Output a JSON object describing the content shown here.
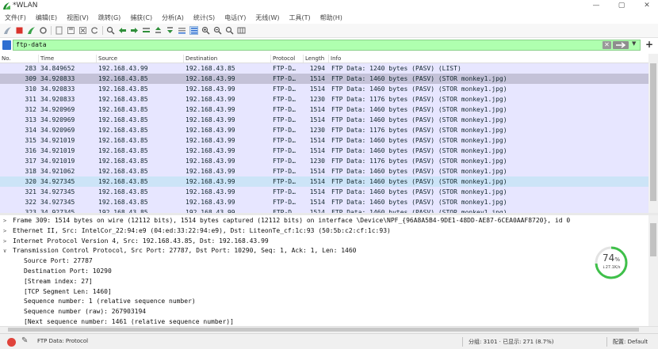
{
  "window": {
    "title": "*WLAN",
    "minimize": "—",
    "maximize": "▢",
    "close": "✕"
  },
  "menu": [
    "文件(F)",
    "编辑(E)",
    "视图(V)",
    "跳转(G)",
    "捕获(C)",
    "分析(A)",
    "统计(S)",
    "电话(Y)",
    "无线(W)",
    "工具(T)",
    "帮助(H)"
  ],
  "filter": {
    "value": "ftp-data",
    "clear": "✕",
    "dropdown": "▼",
    "add": "+"
  },
  "columns": [
    "No.",
    "Time",
    "Source",
    "Destination",
    "Protocol",
    "Length",
    "Info"
  ],
  "packets": [
    {
      "no": "283",
      "time": "34.849652",
      "src": "192.168.43.99",
      "dst": "192.168.43.85",
      "proto": "FTP-D…",
      "len": "1294",
      "info": "FTP Data: 1240 bytes (PASV) (LIST)"
    },
    {
      "no": "309",
      "time": "34.920833",
      "src": "192.168.43.85",
      "dst": "192.168.43.99",
      "proto": "FTP-D…",
      "len": "1514",
      "info": "FTP Data: 1460 bytes (PASV) (STOR monkey1.jpg)"
    },
    {
      "no": "310",
      "time": "34.920833",
      "src": "192.168.43.85",
      "dst": "192.168.43.99",
      "proto": "FTP-D…",
      "len": "1514",
      "info": "FTP Data: 1460 bytes (PASV) (STOR monkey1.jpg)"
    },
    {
      "no": "311",
      "time": "34.920833",
      "src": "192.168.43.85",
      "dst": "192.168.43.99",
      "proto": "FTP-D…",
      "len": "1230",
      "info": "FTP Data: 1176 bytes (PASV) (STOR monkey1.jpg)"
    },
    {
      "no": "312",
      "time": "34.920969",
      "src": "192.168.43.85",
      "dst": "192.168.43.99",
      "proto": "FTP-D…",
      "len": "1514",
      "info": "FTP Data: 1460 bytes (PASV) (STOR monkey1.jpg)"
    },
    {
      "no": "313",
      "time": "34.920969",
      "src": "192.168.43.85",
      "dst": "192.168.43.99",
      "proto": "FTP-D…",
      "len": "1514",
      "info": "FTP Data: 1460 bytes (PASV) (STOR monkey1.jpg)"
    },
    {
      "no": "314",
      "time": "34.920969",
      "src": "192.168.43.85",
      "dst": "192.168.43.99",
      "proto": "FTP-D…",
      "len": "1230",
      "info": "FTP Data: 1176 bytes (PASV) (STOR monkey1.jpg)"
    },
    {
      "no": "315",
      "time": "34.921019",
      "src": "192.168.43.85",
      "dst": "192.168.43.99",
      "proto": "FTP-D…",
      "len": "1514",
      "info": "FTP Data: 1460 bytes (PASV) (STOR monkey1.jpg)"
    },
    {
      "no": "316",
      "time": "34.921019",
      "src": "192.168.43.85",
      "dst": "192.168.43.99",
      "proto": "FTP-D…",
      "len": "1514",
      "info": "FTP Data: 1460 bytes (PASV) (STOR monkey1.jpg)"
    },
    {
      "no": "317",
      "time": "34.921019",
      "src": "192.168.43.85",
      "dst": "192.168.43.99",
      "proto": "FTP-D…",
      "len": "1230",
      "info": "FTP Data: 1176 bytes (PASV) (STOR monkey1.jpg)"
    },
    {
      "no": "318",
      "time": "34.921062",
      "src": "192.168.43.85",
      "dst": "192.168.43.99",
      "proto": "FTP-D…",
      "len": "1514",
      "info": "FTP Data: 1460 bytes (PASV) (STOR monkey1.jpg)"
    },
    {
      "no": "320",
      "time": "34.927345",
      "src": "192.168.43.85",
      "dst": "192.168.43.99",
      "proto": "FTP-D…",
      "len": "1514",
      "info": "FTP Data: 1460 bytes (PASV) (STOR monkey1.jpg)"
    },
    {
      "no": "321",
      "time": "34.927345",
      "src": "192.168.43.85",
      "dst": "192.168.43.99",
      "proto": "FTP-D…",
      "len": "1514",
      "info": "FTP Data: 1460 bytes (PASV) (STOR monkey1.jpg)"
    },
    {
      "no": "322",
      "time": "34.927345",
      "src": "192.168.43.85",
      "dst": "192.168.43.99",
      "proto": "FTP-D…",
      "len": "1514",
      "info": "FTP Data: 1460 bytes (PASV) (STOR monkey1.jpg)"
    },
    {
      "no": "323",
      "time": "34.927345",
      "src": "192.168.43.85",
      "dst": "192.168.43.99",
      "proto": "FTP-D…",
      "len": "1514",
      "info": "FTP Data: 1460 bytes (PASV) (STOR monkey1.jpg)"
    }
  ],
  "selected_packet_index": 1,
  "highlighted_packet_index": 11,
  "details": [
    {
      "twisty": ">",
      "indent": 0,
      "text": "Frame 309: 1514 bytes on wire (12112 bits), 1514 bytes captured (12112 bits) on interface \\Device\\NPF_{96A8A5B4-9DE1-48DD-AE87-6CEA0AAF8720}, id 0"
    },
    {
      "twisty": ">",
      "indent": 0,
      "text": "Ethernet II, Src: IntelCor_22:94:e9 (04:ed:33:22:94:e9), Dst: LiteonTe_cf:1c:93 (50:5b:c2:cf:1c:93)"
    },
    {
      "twisty": ">",
      "indent": 0,
      "text": "Internet Protocol Version 4, Src: 192.168.43.85, Dst: 192.168.43.99"
    },
    {
      "twisty": "∨",
      "indent": 0,
      "text": "Transmission Control Protocol, Src Port: 27787, Dst Port: 10290, Seq: 1, Ack: 1, Len: 1460"
    },
    {
      "twisty": "",
      "indent": 1,
      "text": "Source Port: 27787"
    },
    {
      "twisty": "",
      "indent": 1,
      "text": "Destination Port: 10290"
    },
    {
      "twisty": "",
      "indent": 1,
      "text": "[Stream index: 27]"
    },
    {
      "twisty": "",
      "indent": 1,
      "text": "[TCP Segment Len: 1460]"
    },
    {
      "twisty": "",
      "indent": 1,
      "text": "Sequence number: 1    (relative sequence number)"
    },
    {
      "twisty": "",
      "indent": 1,
      "text": "Sequence number (raw): 267903194"
    },
    {
      "twisty": "",
      "indent": 1,
      "text": "[Next sequence number: 1461    (relative sequence number)]"
    }
  ],
  "gauge": {
    "percent": "74",
    "unit": "%",
    "rate": "↓27.1K/s",
    "fraction": 0.74
  },
  "status": {
    "text": "FTP Data: Protocol",
    "packets": "分组: 3101 · 已显示: 271 (8.7%)",
    "profile": "配置: Default"
  },
  "colors": {
    "row_bg": "#e7e6ff",
    "row_selected": "#c4c2d8",
    "row_highlight": "#cce4f7",
    "filter_ok": "#afffaf"
  }
}
